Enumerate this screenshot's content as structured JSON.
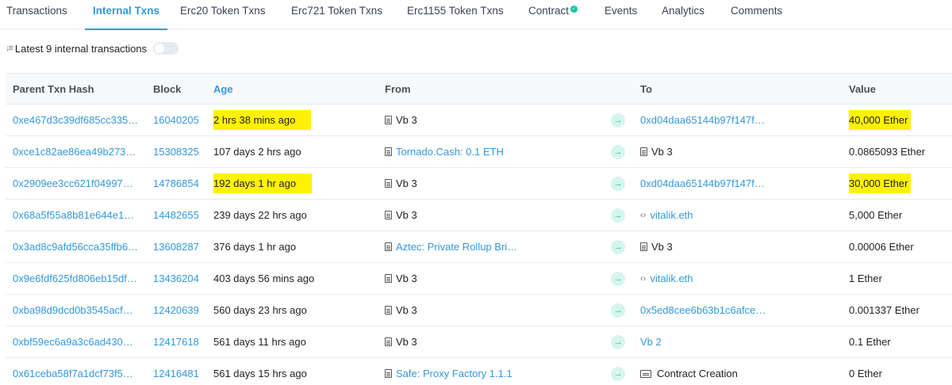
{
  "tabs": [
    {
      "label": "Transactions",
      "active": false
    },
    {
      "label": "Internal Txns",
      "active": true
    },
    {
      "label": "Erc20 Token Txns",
      "active": false
    },
    {
      "label": "Erc721 Token Txns",
      "active": false
    },
    {
      "label": "Erc1155 Token Txns",
      "active": false
    },
    {
      "label": "Contract",
      "active": false,
      "verified_icon": "check-circle-icon"
    },
    {
      "label": "Events",
      "active": false
    },
    {
      "label": "Analytics",
      "active": false
    },
    {
      "label": "Comments",
      "active": false
    }
  ],
  "summary": {
    "sort_icon": "sort-descending-icon",
    "text": "Latest 9 internal transactions",
    "toggle_on": false
  },
  "table": {
    "headers": {
      "parent_txn_hash": "Parent Txn Hash",
      "block": "Block",
      "age": "Age",
      "from": "From",
      "to": "To",
      "value": "Value"
    },
    "rows": [
      {
        "hash": "0xe467d3c39df685cc335…",
        "block": "16040205",
        "age": "2 hrs 38 mins ago",
        "from": "Vb 3",
        "from_icon": "contract-icon",
        "from_link": false,
        "to": "0xd04daa65144b97f147f…",
        "to_icon": "",
        "to_link": true,
        "value": "40,000 Ether",
        "highlight_age": true,
        "highlight_value": true
      },
      {
        "hash": "0xce1c82ae86ea49b273…",
        "block": "15308325",
        "age": "107 days 2 hrs ago",
        "from": "Tornado.Cash: 0.1 ETH",
        "from_icon": "contract-icon",
        "from_link": true,
        "to": "Vb 3",
        "to_icon": "contract-icon",
        "to_link": false,
        "value": "0.0865093 Ether",
        "highlight_age": false,
        "highlight_value": false
      },
      {
        "hash": "0x2909ee3cc621f04997…",
        "block": "14786854",
        "age": "192 days 1 hr ago",
        "from": "Vb 3",
        "from_icon": "contract-icon",
        "from_link": false,
        "to": "0xd04daa65144b97f147f…",
        "to_icon": "",
        "to_link": true,
        "value": "30,000 Ether",
        "highlight_age": true,
        "highlight_value": true
      },
      {
        "hash": "0x68a5f55a8b81e644e1…",
        "block": "14482655",
        "age": "239 days 22 hrs ago",
        "from": "Vb 3",
        "from_icon": "contract-icon",
        "from_link": false,
        "to": "vitalik.eth",
        "to_icon": "ens-icon",
        "to_link": true,
        "value": "5,000 Ether",
        "highlight_age": false,
        "highlight_value": false
      },
      {
        "hash": "0x3ad8c9afd56cca35ffb6…",
        "block": "13608287",
        "age": "376 days 1 hr ago",
        "from": "Aztec: Private Rollup Bri…",
        "from_icon": "contract-icon",
        "from_link": true,
        "to": "Vb 3",
        "to_icon": "contract-icon",
        "to_link": false,
        "value": "0.00006 Ether",
        "highlight_age": false,
        "highlight_value": false
      },
      {
        "hash": "0x9e6fdf625fd806eb15df…",
        "block": "13436204",
        "age": "403 days 56 mins ago",
        "from": "Vb 3",
        "from_icon": "contract-icon",
        "from_link": false,
        "to": "vitalik.eth",
        "to_icon": "ens-icon",
        "to_link": true,
        "value": "1 Ether",
        "highlight_age": false,
        "highlight_value": false
      },
      {
        "hash": "0xba98d9dcd0b3545acf…",
        "block": "12420639",
        "age": "560 days 23 hrs ago",
        "from": "Vb 3",
        "from_icon": "contract-icon",
        "from_link": false,
        "to": "0x5ed8cee6b63b1c6afce…",
        "to_icon": "",
        "to_link": true,
        "value": "0.001337 Ether",
        "highlight_age": false,
        "highlight_value": false
      },
      {
        "hash": "0xbf59ec6a9a3c6ad430…",
        "block": "12417618",
        "age": "561 days 11 hrs ago",
        "from": "Vb 3",
        "from_icon": "contract-icon",
        "from_link": false,
        "to": "Vb 2",
        "to_icon": "",
        "to_link": true,
        "value": "0.1 Ether",
        "highlight_age": false,
        "highlight_value": false
      },
      {
        "hash": "0x61ceba58f7a1dcf73f5…",
        "block": "12416481",
        "age": "561 days 15 hrs ago",
        "from": "Safe: Proxy Factory 1.1.1",
        "from_icon": "contract-icon",
        "from_link": true,
        "to": "Contract Creation",
        "to_icon": "contract-creation-icon",
        "to_link": false,
        "value": "0 Ether",
        "highlight_age": false,
        "highlight_value": false
      }
    ]
  },
  "colors": {
    "link": "#3498db",
    "highlight": "#fff200",
    "arrow_badge": "#00c9a7"
  }
}
